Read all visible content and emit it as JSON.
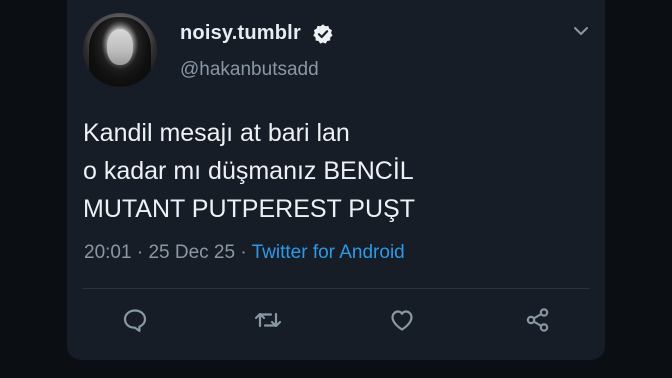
{
  "tweet": {
    "display_name": "noisy.tumblr",
    "handle": "@hakanbutsadd",
    "text_lines": [
      "Kandil mesajı at bari lan",
      "o kadar mı düşmanız BENCİL",
      "MUTANT PUTPEREST PUŞT"
    ],
    "time": "20:01",
    "date": "25 Dec 25",
    "separator": "·",
    "source": "Twitter for Android"
  },
  "icons": {
    "verified": "verified-badge-icon",
    "menu": "chevron-down-icon",
    "reply": "reply-icon",
    "retweet": "retweet-icon",
    "like": "heart-icon",
    "share": "share-icon"
  },
  "colors": {
    "background": "#0b0e13",
    "card": "#161d27",
    "text": "#eef1f4",
    "muted": "#8a97a4",
    "link": "#2f98e6"
  }
}
